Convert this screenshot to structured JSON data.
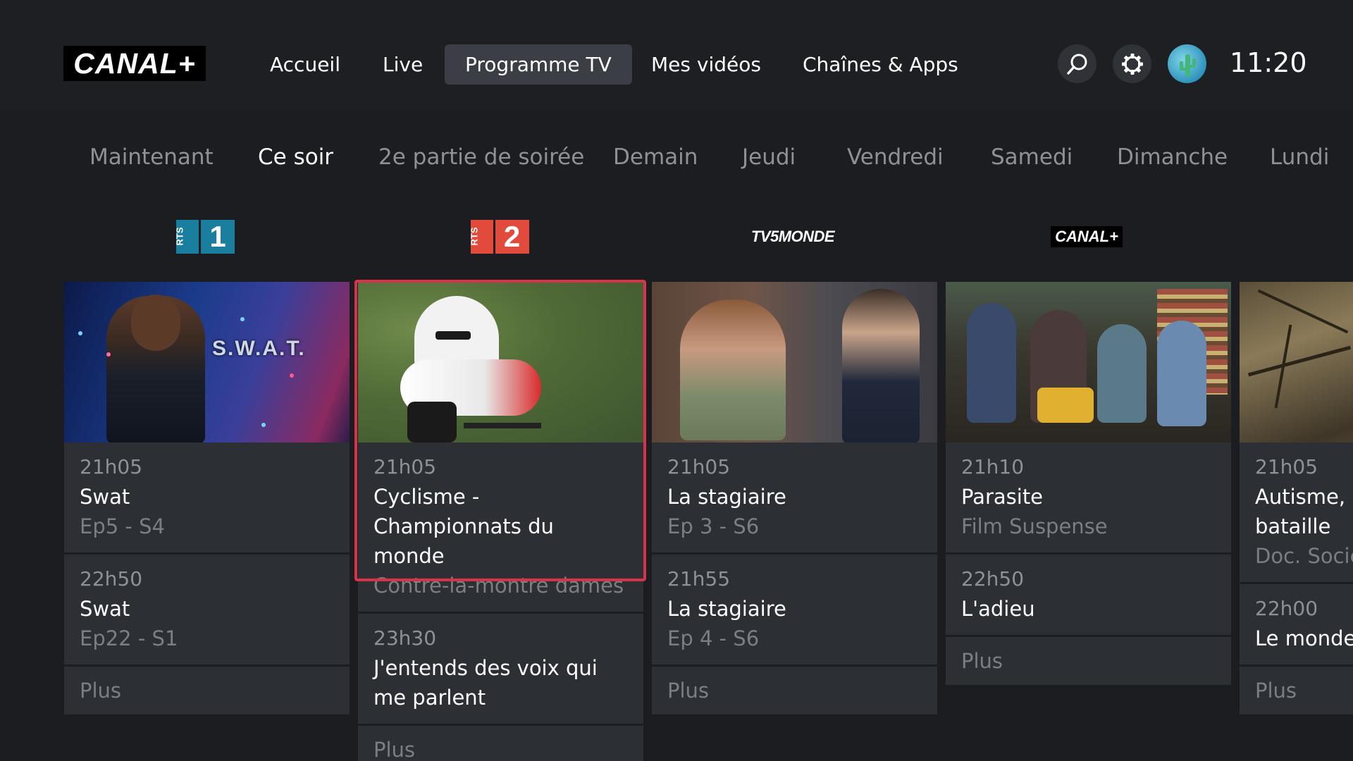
{
  "header": {
    "logo": "CANAL+",
    "nav": [
      {
        "label": "Accueil"
      },
      {
        "label": "Live"
      },
      {
        "label": "Programme TV",
        "active": true
      },
      {
        "label": "Mes vidéos"
      },
      {
        "label": "Chaînes & Apps"
      }
    ],
    "search_icon": "search-icon",
    "settings_icon": "gear-icon",
    "clock": "11:20"
  },
  "days": [
    {
      "label": "Maintenant"
    },
    {
      "label": "Ce soir",
      "active": true
    },
    {
      "label": "2e partie de soirée"
    },
    {
      "label": "Demain"
    },
    {
      "label": "Jeudi"
    },
    {
      "label": "Vendredi"
    },
    {
      "label": "Samedi"
    },
    {
      "label": "Dimanche"
    },
    {
      "label": "Lundi"
    }
  ],
  "channels": [
    {
      "logo_text": "RTS",
      "logo_number": "1",
      "logo_color": "#1a7f9e",
      "programs": [
        {
          "time": "21h05",
          "title": "Swat",
          "subtitle": "Ep5 - S4"
        },
        {
          "time": "22h50",
          "title": "Swat",
          "subtitle": "Ep22 - S1"
        }
      ],
      "more": "Plus"
    },
    {
      "logo_text": "RTS",
      "logo_number": "2",
      "logo_color": "#e24a3b",
      "programs": [
        {
          "time": "21h05",
          "title": "Cyclisme - Championnats du monde",
          "subtitle": "Contre-la-montre dames"
        },
        {
          "time": "23h30",
          "title": "J'entends des voix qui me parlent",
          "subtitle": ""
        }
      ],
      "more": "Plus"
    },
    {
      "logo_text": "TV5MONDE",
      "programs": [
        {
          "time": "21h05",
          "title": "La stagiaire",
          "subtitle": "Ep 3 - S6"
        },
        {
          "time": "21h55",
          "title": "La stagiaire",
          "subtitle": "Ep 4 - S6"
        }
      ],
      "more": "Plus"
    },
    {
      "logo_text": "CANAL+",
      "programs": [
        {
          "time": "21h10",
          "title": "Parasite",
          "subtitle": "Film Suspense"
        },
        {
          "time": "22h50",
          "title": "L'adieu",
          "subtitle": ""
        }
      ],
      "more": "Plus"
    },
    {
      "logo_text": "",
      "programs": [
        {
          "time": "21h05",
          "title": "Autisme, r bataille",
          "subtitle": "Doc. Socié"
        },
        {
          "time": "22h00",
          "title": "Le monde",
          "subtitle": ""
        }
      ],
      "more": "Plus"
    }
  ],
  "thumb_text": {
    "swat": "S.W.A.T."
  },
  "colors": {
    "accent_focus": "#d8334a",
    "background": "#1b1d21",
    "card": "#2c2f34"
  }
}
